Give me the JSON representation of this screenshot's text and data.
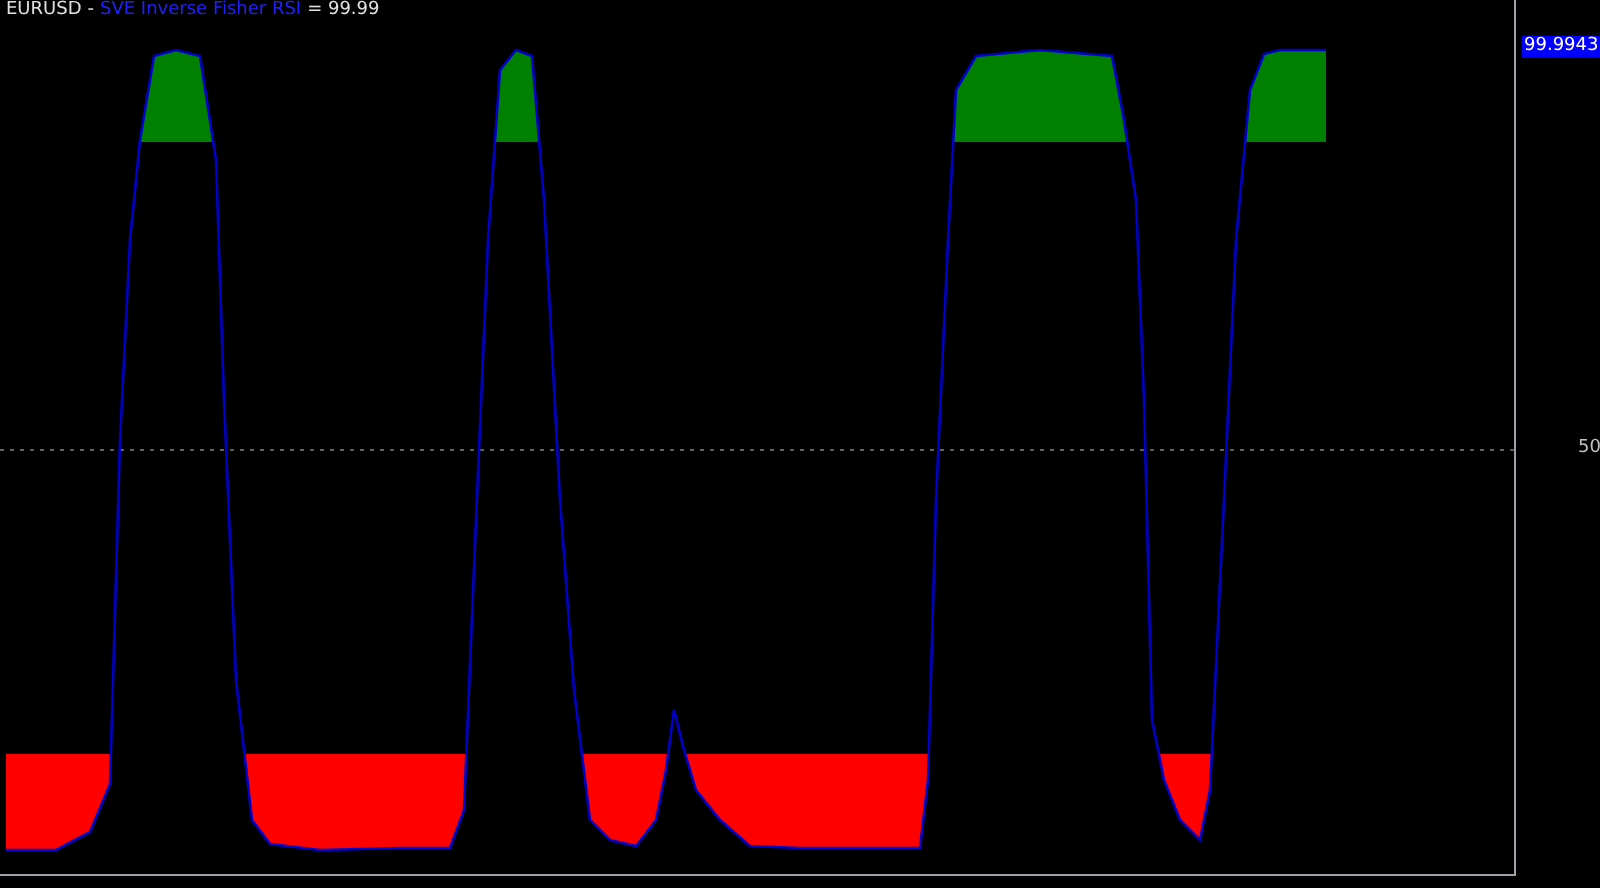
{
  "header": {
    "symbol": "EURUSD",
    "separator": "-",
    "indicator": "SVE Inverse Fisher RSI",
    "value_text": "= 99.99"
  },
  "axis": {
    "level_label": "50",
    "current_value": "99.9943"
  }
}
